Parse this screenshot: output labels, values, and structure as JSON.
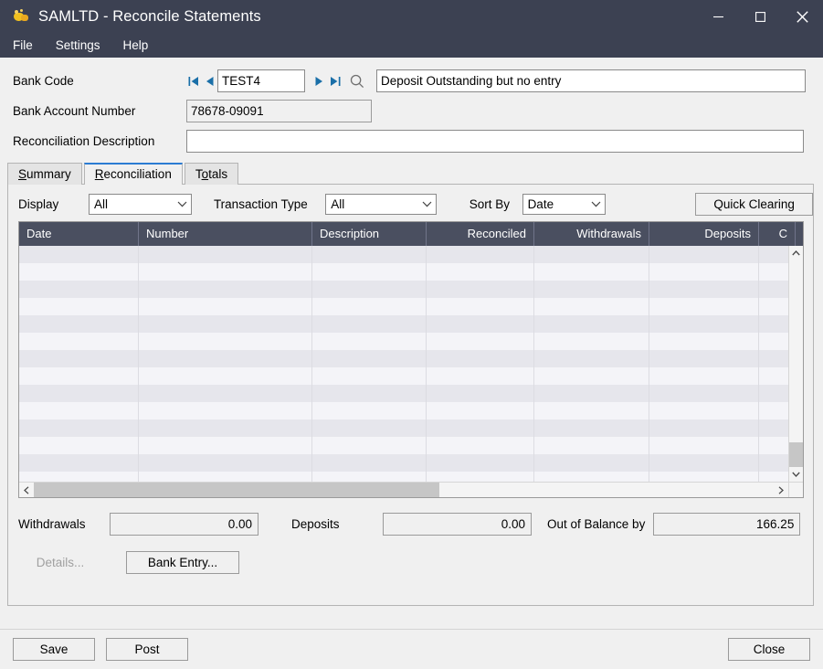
{
  "window": {
    "title": "SAMLTD - Reconcile Statements",
    "app_icon": "app-icon",
    "minimize_label": "Minimize",
    "maximize_label": "Maximize",
    "close_label": "Close"
  },
  "menubar": {
    "items": [
      {
        "label": "File"
      },
      {
        "label": "Settings"
      },
      {
        "label": "Help"
      }
    ]
  },
  "header": {
    "bank_code_label": "Bank Code",
    "bank_code_value": "TEST4",
    "bank_code_description": "Deposit Outstanding but no entry",
    "nav": {
      "first": "first-record-icon",
      "prev": "previous-record-icon",
      "next": "next-record-icon",
      "last": "last-record-icon",
      "finder": "magnifier-icon"
    },
    "bank_account_label": "Bank Account Number",
    "bank_account_value": "78678-09091",
    "reconciliation_description_label": "Reconciliation Description",
    "reconciliation_description_value": ""
  },
  "tabs": [
    {
      "label": "Summary",
      "accel": "S",
      "active": false
    },
    {
      "label": "Reconciliation",
      "accel": "R",
      "active": true
    },
    {
      "label": "Totals",
      "accel": "o",
      "active": false
    }
  ],
  "filters": {
    "display_label": "Display",
    "display_value": "All",
    "display_options": [
      "All"
    ],
    "transaction_type_label": "Transaction Type",
    "transaction_type_value": "All",
    "transaction_type_options": [
      "All"
    ],
    "sort_by_label": "Sort By",
    "sort_by_value": "Date",
    "sort_by_options": [
      "Date"
    ],
    "quick_clearing_label": "Quick Clearing"
  },
  "grid": {
    "columns": [
      {
        "label": "Date",
        "width": 131,
        "align": "left"
      },
      {
        "label": "Number",
        "width": 190,
        "align": "left"
      },
      {
        "label": "Description",
        "width": 125,
        "align": "left"
      },
      {
        "label": "Reconciled",
        "width": 118,
        "align": "right"
      },
      {
        "label": "Withdrawals",
        "width": 126,
        "align": "right"
      },
      {
        "label": "Deposits",
        "width": 120,
        "align": "right"
      },
      {
        "label": "C",
        "width": 40,
        "align": "right"
      }
    ],
    "rows": [],
    "empty_row_count": 14,
    "scroll": {
      "vertical": "vertical-scrollbar",
      "horizontal": "horizontal-scrollbar"
    }
  },
  "totals": {
    "withdrawals_label": "Withdrawals",
    "withdrawals_value": "0.00",
    "deposits_label": "Deposits",
    "deposits_value": "0.00",
    "out_of_balance_label": "Out of Balance by",
    "out_of_balance_value": "166.25"
  },
  "actions": {
    "details_label": "Details...",
    "details_disabled": true,
    "bank_entry_label": "Bank Entry..."
  },
  "footer": {
    "save_label": "Save",
    "post_label": "Post",
    "close_label": "Close"
  },
  "colors": {
    "titlebar": "#3c4152",
    "grid_header": "#4a4f60",
    "accent": "#2b7cd3",
    "nav_arrow": "#1a6fa8",
    "panel": "#f0f0f0"
  }
}
